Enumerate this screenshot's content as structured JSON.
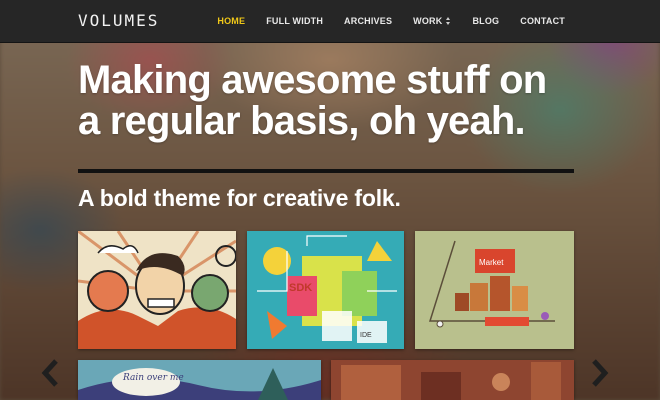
{
  "site": {
    "logo": "VOLUMES"
  },
  "nav": {
    "items": [
      {
        "label": "HOME",
        "active": true
      },
      {
        "label": "FULL WIDTH",
        "active": false
      },
      {
        "label": "ARCHIVES",
        "active": false
      },
      {
        "label": "WORK",
        "active": false,
        "has_dropdown": true
      },
      {
        "label": "BLOG",
        "active": false
      },
      {
        "label": "CONTACT",
        "active": false
      }
    ],
    "active_color": "#f0c818"
  },
  "hero": {
    "headline_line1": "Making awesome stuff on",
    "headline_line2": "a regular basis, oh yeah.",
    "subheadline": "A bold theme for creative folk."
  },
  "gallery": {
    "items": [
      {
        "icon": "illustration-characters"
      },
      {
        "icon": "illustration-sdk-city",
        "labels": [
          "SDK",
          "IDE"
        ]
      },
      {
        "icon": "illustration-market",
        "labels": [
          "Market"
        ]
      },
      {
        "icon": "illustration-rain",
        "labels": [
          "Rain over me"
        ]
      },
      {
        "icon": "illustration-room"
      }
    ],
    "prev_icon": "chevron-left-icon",
    "next_icon": "chevron-right-icon"
  }
}
